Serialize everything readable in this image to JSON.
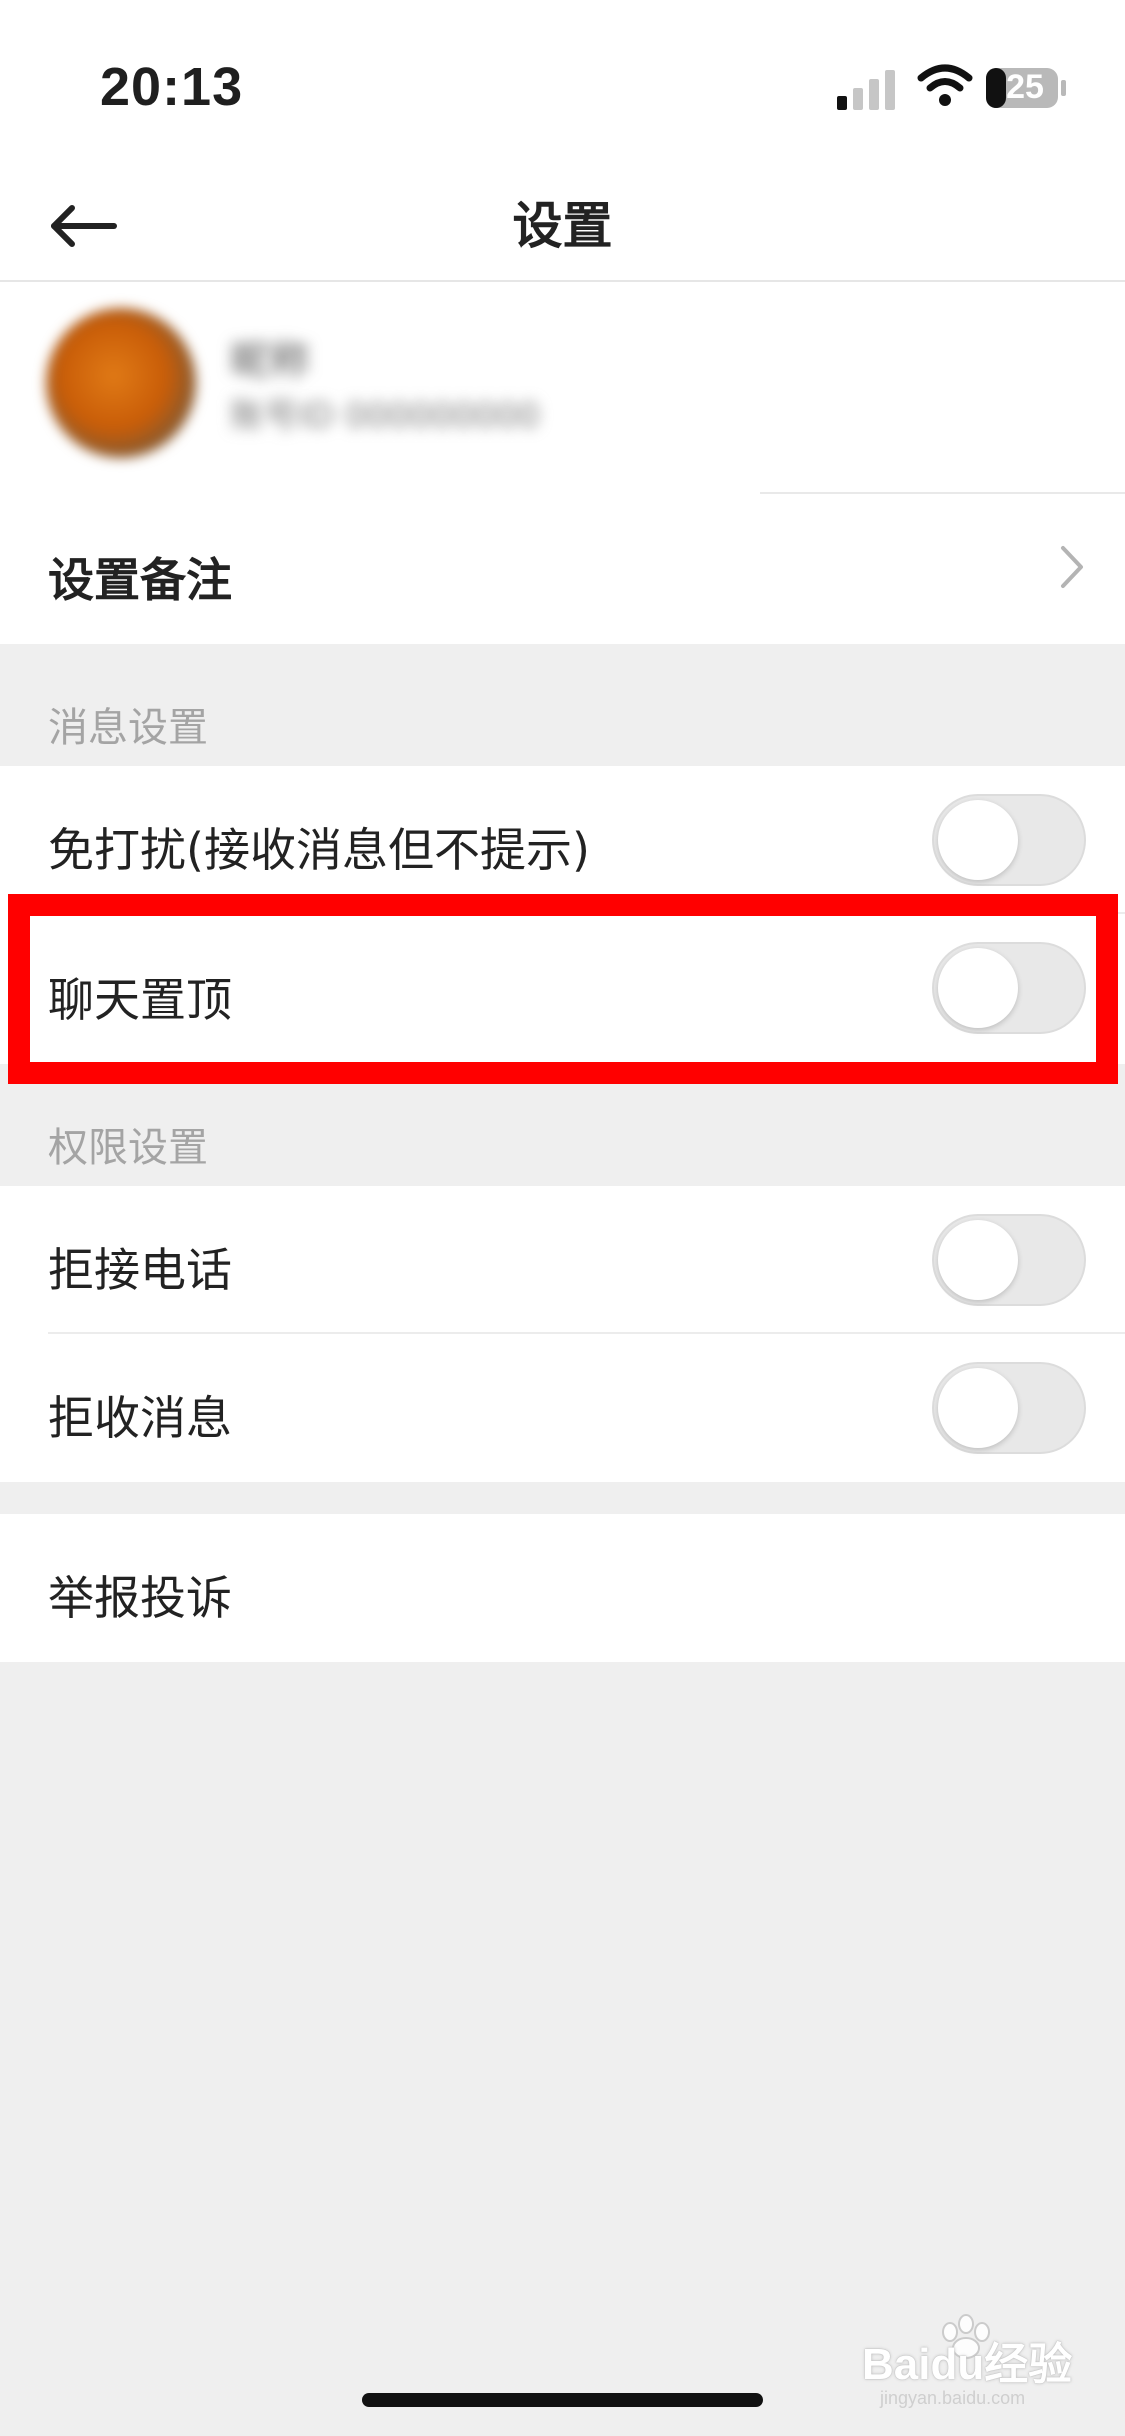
{
  "status_bar": {
    "time": "20:13",
    "battery": "25",
    "icons": [
      "signal-icon",
      "wifi-icon",
      "battery-icon"
    ]
  },
  "nav": {
    "title": "设置",
    "back_icon": "back-arrow-icon"
  },
  "profile": {
    "name": "昵称",
    "id": "账号ID 000000000"
  },
  "remark_row": {
    "label": "设置备注",
    "icon": "chevron-right-icon"
  },
  "message_section": {
    "header": "消息设置",
    "items": [
      {
        "label": "免打扰(接收消息但不提示)",
        "toggle_on": false
      },
      {
        "label": "聊天置顶",
        "toggle_on": false
      }
    ]
  },
  "permission_section": {
    "header": "权限设置",
    "items": [
      {
        "label": "拒接电话",
        "toggle_on": false
      },
      {
        "label": "拒收消息",
        "toggle_on": false
      }
    ]
  },
  "report_row": {
    "label": "举报投诉"
  },
  "watermark": {
    "brand": "Baidu经验",
    "url": "jingyan.baidu.com"
  },
  "colors": {
    "highlight": "#ff0000",
    "background": "#efefef",
    "toggle_off": "#e8e8e8"
  }
}
